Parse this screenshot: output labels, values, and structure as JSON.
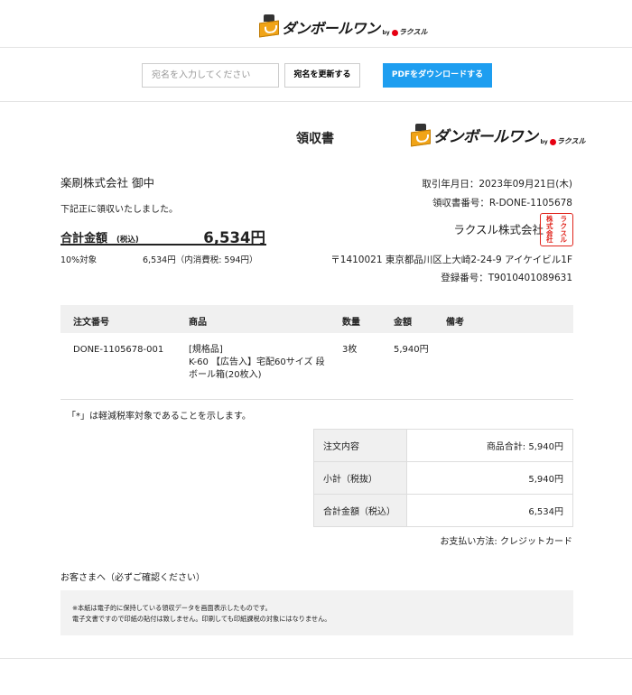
{
  "header": {
    "logo_text": "ダンボールワン",
    "logo_by": "by",
    "logo_brand": "ラクスル"
  },
  "toolbar": {
    "addressee_placeholder": "宛名を入力してください",
    "update_label": "宛名を更新する",
    "pdf_label": "PDFをダウンロードする"
  },
  "receipt": {
    "title": "領収書",
    "recipient": "楽刷株式会社 御中",
    "received_note": "下記正に領収いたしました。",
    "total_label": "合計金額",
    "total_tax_label": "(税込)",
    "total_value": "6,534円",
    "rate_label": "10%対象",
    "rate_amount": "6,534円（内消費税: 594円）"
  },
  "issuer": {
    "date": "取引年月日：2023年09月21日(木)",
    "receipt_no": "領収書番号：R-DONE-1105678",
    "company": "ラクスル株式会社",
    "seal_chars": [
      "ラ",
      "ク",
      "ス",
      "ル",
      "株",
      "式",
      "会",
      "社"
    ],
    "address": "〒1410021 東京都品川区上大崎2-24-9 アイケイビル1F",
    "registration": "登録番号：T9010401089631"
  },
  "items_table": {
    "headers": [
      "注文番号",
      "商品",
      "数量",
      "金額",
      "備考"
    ],
    "rows": [
      {
        "order_no": "DONE-1105678-001",
        "product": "[規格品]\nK-60 【広告入】宅配60サイズ 段\nボール箱(20枚入)",
        "qty": "3枚",
        "amount": "5,940円",
        "remarks": ""
      }
    ]
  },
  "legend_note": "「*」は軽減税率対象であることを示します。",
  "summary": [
    {
      "label": "注文内容",
      "value": "商品合計: 5,940円"
    },
    {
      "label": "小計（税抜）",
      "value": "5,940円"
    },
    {
      "label": "合計金額（税込）",
      "value": "6,534円"
    }
  ],
  "payment_method": "お支払い方法: クレジットカード",
  "customer_note_title": "お客さまへ（必ずご確認ください）",
  "notice_lines": [
    "※本紙は電子的に保持している領収データを画面表示したものです。",
    "電子文書ですので印紙の貼付は致しません。印刷しても印紙課税の対象にはなりません。"
  ],
  "colors": {
    "primary_button": "#1e9ef0",
    "seal_red": "#e0241c",
    "logo_orange": "#f1a417",
    "table_header_bg": "#f0f0f0"
  }
}
